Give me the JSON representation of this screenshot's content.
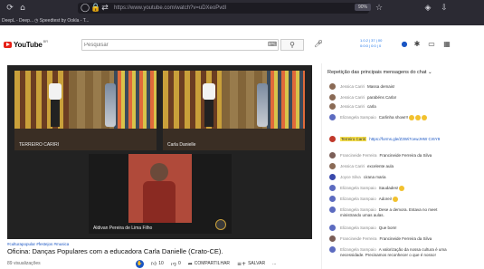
{
  "browser": {
    "url": "https://www.youtube.com/watch?v=uDXeoPvdl",
    "zoom": "90%",
    "bookmarks": [
      "DeepL - Deep...",
      "Speedtest by Ookla - T..."
    ]
  },
  "header": {
    "logo_text": "YouTube",
    "logo_country": "BR",
    "search_placeholder": "Pesquisar",
    "extension_lines": [
      "1.0.2 | 37 | 00",
      "0:0:0 | 0:0 | 0"
    ]
  },
  "video": {
    "tiles": [
      {
        "label": "TERREIRO CARIRI"
      },
      {
        "label": "Carla Danielle"
      },
      {
        "label": "Aldivan Pereira de Lima Filho"
      }
    ],
    "hashtags": "#culturapopular #festejos #musica",
    "title": "Oficina: Danças Populares com a educadora Carla Danielle (Crato-CE).",
    "views": "89 visualizações",
    "likes": "10",
    "dislikes": "0",
    "share_label": "COMPARTILHAR",
    "save_label": "SALVAR",
    "more_label": "..."
  },
  "chat": {
    "header": "Repetição das principais mensagens do chat",
    "messages": [
      {
        "author": "Jessica Cariri",
        "text": "Massa demais!",
        "avatar_color": "#8a6a55",
        "emojis": 0
      },
      {
        "author": "Jessica Cariri",
        "text": "parabéns Carla!",
        "avatar_color": "#8a6a55",
        "emojis": 0
      },
      {
        "author": "Jessica Cariri",
        "text": "carla",
        "avatar_color": "#8a6a55",
        "emojis": 0
      },
      {
        "author": "Elizangela Sampaio",
        "text": "Carlinha show!!!",
        "avatar_color": "#5c6bc0",
        "emojis": 3
      },
      {
        "author": "Terreiro Cariri",
        "text": "https://forms.gle/Z3Wi7cewJHW Cr6Y9",
        "avatar_color": "#c0392b",
        "emojis": 0,
        "highlight": true,
        "is_link": true
      },
      {
        "author": "Francineide Ferreira",
        "text": "Francineide Ferreira da Silva",
        "avatar_color": "#7b5e57",
        "emojis": 0
      },
      {
        "author": "Jessica Cariri",
        "text": "excelente aula",
        "avatar_color": "#8a6a55",
        "emojis": 0
      },
      {
        "author": "Joyce Silva",
        "text": "cirana maria",
        "avatar_color": "#3949ab",
        "emojis": 0
      },
      {
        "author": "Elizangela Sampaio",
        "text": "Saudades!",
        "avatar_color": "#5c6bc0",
        "emojis": 1
      },
      {
        "author": "Elizangela Sampaio",
        "text": "Adorei!",
        "avatar_color": "#5c6bc0",
        "emojis": 1
      },
      {
        "author": "Elizangela Sampaio",
        "text": "Dese a demora. Estava no meet ministrando umas aulas.",
        "avatar_color": "#5c6bc0",
        "emojis": 0
      },
      {
        "author": "Elizangela Sampaio",
        "text": "Que bom!",
        "avatar_color": "#5c6bc0",
        "emojis": 0
      },
      {
        "author": "Francineide Ferreira",
        "text": "Francineide Ferreira da Silva",
        "avatar_color": "#7b5e57",
        "emojis": 0
      },
      {
        "author": "Elizangela Sampaio",
        "text": "A valorização da nossa cultura é uma necessidade. Precisamos reconhecer o que é nosso!",
        "avatar_color": "#5c6bc0",
        "emojis": 0
      }
    ]
  }
}
